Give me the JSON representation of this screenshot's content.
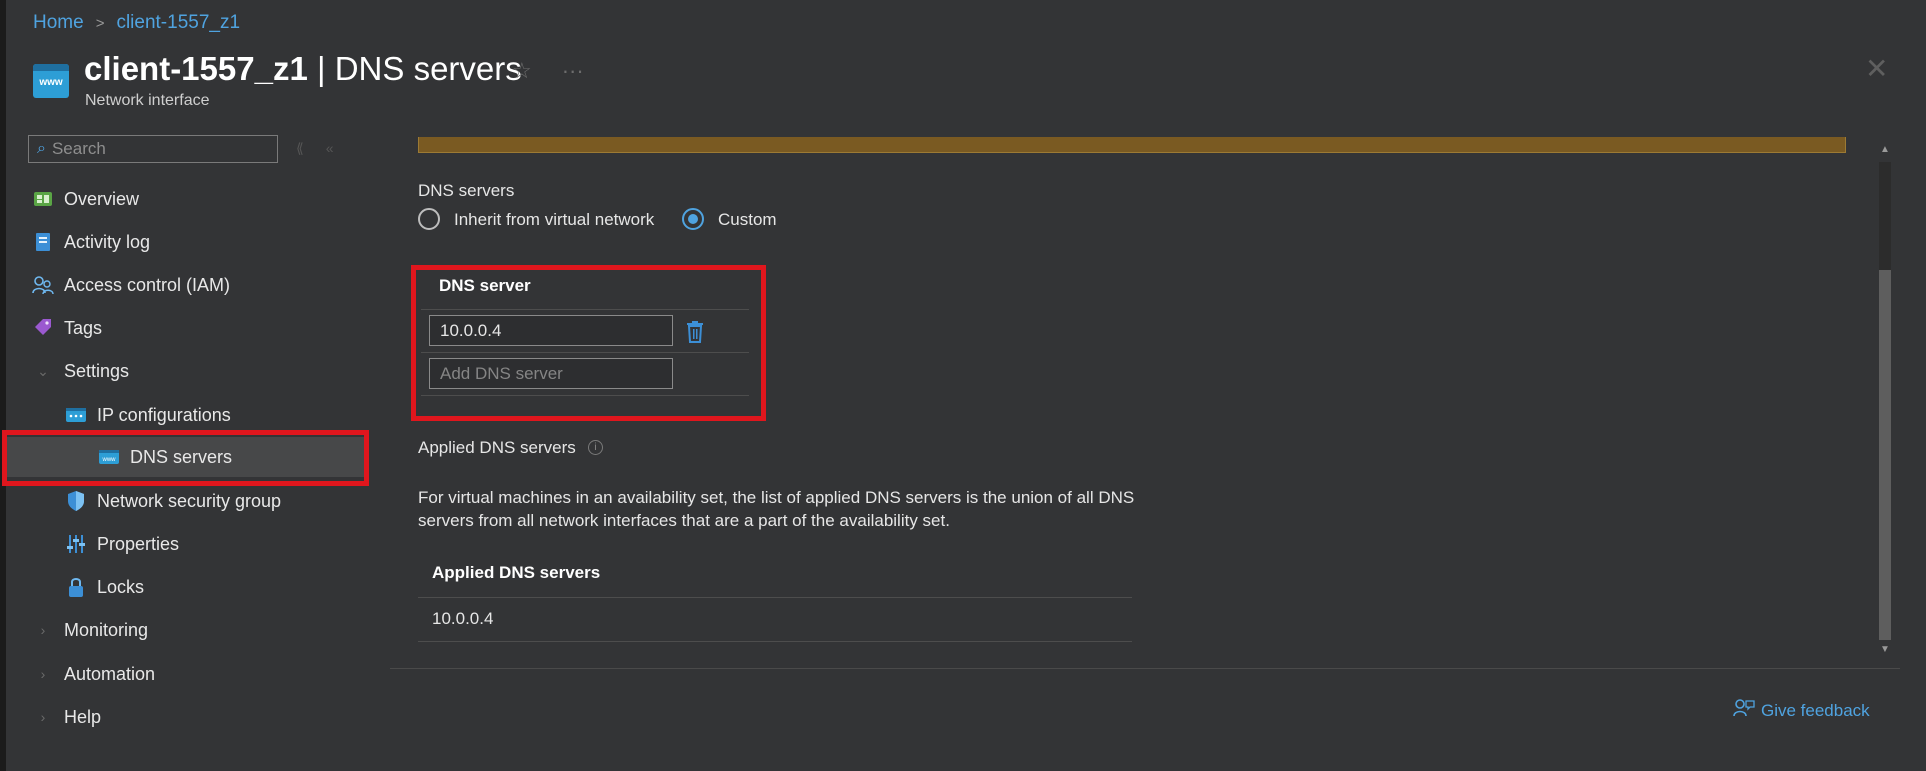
{
  "breadcrumb": {
    "home": "Home",
    "sep": ">",
    "current": "client-1557_z1"
  },
  "header": {
    "resource_icon_text": "www",
    "title_bold": "client-1557_z1",
    "title_rest": " | DNS servers",
    "subtitle": "Network interface",
    "star_icon": "☆",
    "more_icon": "···",
    "close_icon": "✕"
  },
  "sidebar": {
    "search_placeholder": "Search",
    "search_icon": "⌕",
    "tool_a": "⟪",
    "tool_b": "«",
    "items": [
      {
        "label": "Overview",
        "icon": "overview-icon"
      },
      {
        "label": "Activity log",
        "icon": "activity-log-icon"
      },
      {
        "label": "Access control (IAM)",
        "icon": "iam-icon"
      },
      {
        "label": "Tags",
        "icon": "tag-icon"
      },
      {
        "label": "Settings",
        "icon": "chevron-down-icon"
      },
      {
        "label": "IP configurations",
        "icon": "ip-config-icon"
      },
      {
        "label": "DNS servers",
        "icon": "dns-icon",
        "selected": true
      },
      {
        "label": "Network security group",
        "icon": "shield-icon"
      },
      {
        "label": "Properties",
        "icon": "properties-icon"
      },
      {
        "label": "Locks",
        "icon": "lock-icon"
      },
      {
        "label": "Monitoring",
        "icon": "chevron-right-icon"
      },
      {
        "label": "Automation",
        "icon": "chevron-right-icon"
      },
      {
        "label": "Help",
        "icon": "chevron-right-icon"
      }
    ],
    "chev_down": "⌄",
    "chev_right": "›"
  },
  "main": {
    "dns_servers_label": "DNS servers",
    "radio_inherit": "Inherit from virtual network",
    "radio_custom": "Custom",
    "selected_option": "Custom",
    "dns_table_header": "DNS server",
    "dns_entries": [
      "10.0.0.4"
    ],
    "add_placeholder": "Add DNS server",
    "applied_label": "Applied DNS servers",
    "info_icon": "i",
    "description": "For virtual machines in an availability set, the list of applied DNS servers is the union of all DNS servers from all network interfaces that are a part of the availability set.",
    "applied_table_header": "Applied DNS servers",
    "applied_entries": [
      "10.0.0.4"
    ],
    "scroll_up": "▲",
    "scroll_down": "▼"
  },
  "footer": {
    "feedback": "Give feedback"
  },
  "colors": {
    "accent": "#4fa3e0",
    "highlight": "#e0161d",
    "background": "#333436",
    "warning": "#7a5a22"
  }
}
